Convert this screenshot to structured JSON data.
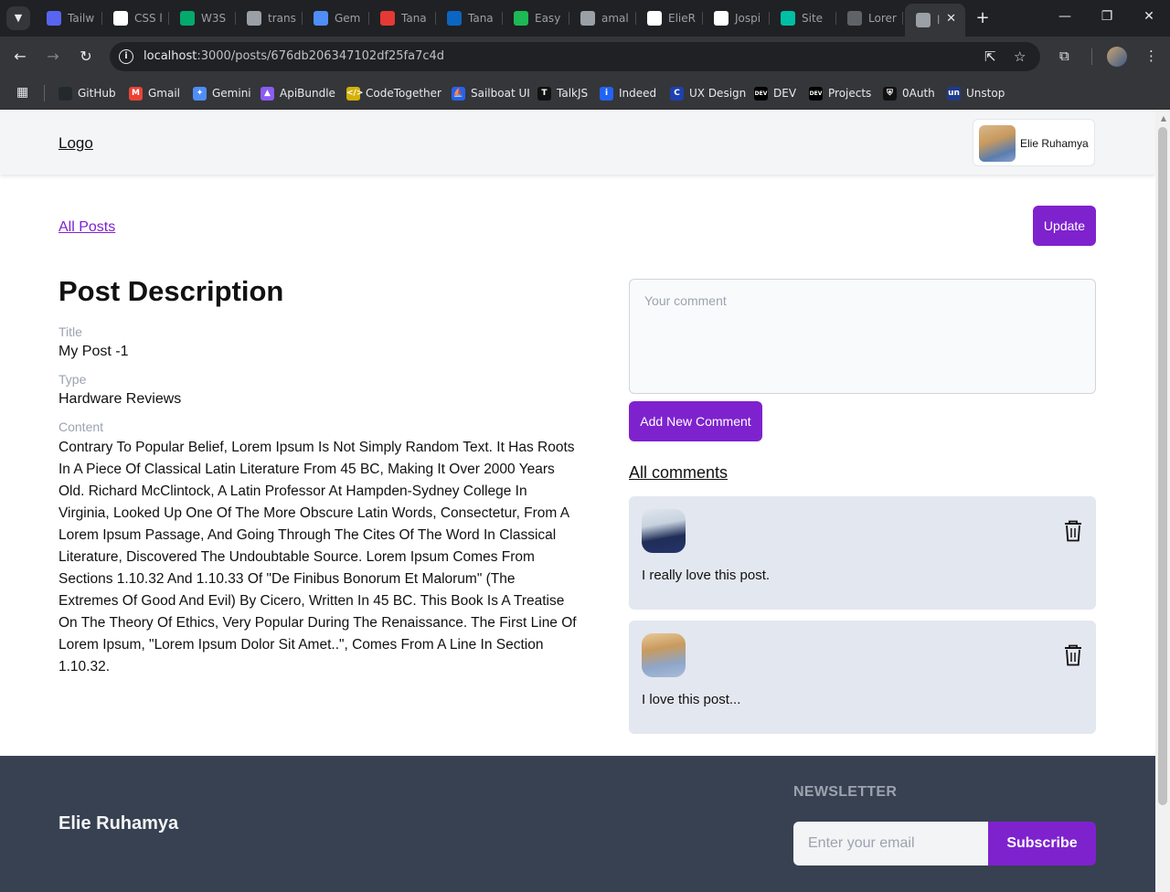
{
  "browser": {
    "tabs": [
      {
        "label": "Tailw",
        "icon": "tailwind-icon",
        "color": "#5865f2"
      },
      {
        "label": "CSS l",
        "icon": "circle-icon",
        "color": "#ffffff"
      },
      {
        "label": "W3S",
        "icon": "w3schools-icon",
        "color": "#04aa6d"
      },
      {
        "label": "trans",
        "icon": "translate-icon",
        "color": "#9aa0a6"
      },
      {
        "label": "Gem",
        "icon": "gemini-icon",
        "color": "#4f8ef7"
      },
      {
        "label": "Tana",
        "icon": "tana-icon",
        "color": "#e53935"
      },
      {
        "label": "Tana",
        "icon": "linkedin-icon",
        "color": "#0a66c2"
      },
      {
        "label": "Easy",
        "icon": "easy-icon",
        "color": "#1db954"
      },
      {
        "label": "amal",
        "icon": "globe-icon",
        "color": "#9aa0a6"
      },
      {
        "label": "ElieR",
        "icon": "github-icon",
        "color": "#ffffff"
      },
      {
        "label": "Jospi",
        "icon": "github-icon",
        "color": "#ffffff"
      },
      {
        "label": "Site",
        "icon": "diamond-icon",
        "color": "#00bfa5"
      },
      {
        "label": "Lorer",
        "icon": "lorem-icon",
        "color": "#5f6368"
      },
      {
        "label": "l",
        "icon": "globe-icon",
        "color": "#9aa0a6",
        "active": true
      }
    ],
    "url_host": "localhost",
    "url_path": ":3000/posts/676db206347102df25fa7c4d",
    "bookmarks": [
      {
        "label": "GitHub",
        "icon": "github-icon",
        "color": "#24292e",
        "glyph": ""
      },
      {
        "label": "Gmail",
        "icon": "gmail-icon",
        "color": "#ea4335",
        "glyph": "M"
      },
      {
        "label": "Gemini",
        "icon": "gemini-icon",
        "color": "#4f8ef7",
        "glyph": "✦"
      },
      {
        "label": "ApiBundle",
        "icon": "apibundle-icon",
        "color": "#8b5cf6",
        "glyph": "▲"
      },
      {
        "label": "CodeTogether",
        "icon": "codetogether-icon",
        "color": "#d4b106",
        "glyph": "</>"
      },
      {
        "label": "Sailboat UI",
        "icon": "sailboat-icon",
        "color": "#2563eb",
        "glyph": "⛵"
      },
      {
        "label": "TalkJS",
        "icon": "talkjs-icon",
        "color": "#111111",
        "glyph": "T"
      },
      {
        "label": "Indeed",
        "icon": "indeed-icon",
        "color": "#2164f3",
        "glyph": "i"
      },
      {
        "label": "UX Design",
        "icon": "uxdesign-icon",
        "color": "#1e40af",
        "glyph": "C"
      },
      {
        "label": "DEV",
        "icon": "dev-icon",
        "color": "#000000",
        "glyph": "DEV"
      },
      {
        "label": "Projects",
        "icon": "dev-icon",
        "color": "#000000",
        "glyph": "DEV"
      },
      {
        "label": "0Auth",
        "icon": "shield-icon",
        "color": "#111111",
        "glyph": "⛨"
      },
      {
        "label": "Unstop",
        "icon": "unstop-icon",
        "color": "#1e3a8a",
        "glyph": "un"
      }
    ]
  },
  "header": {
    "logo": "Logo",
    "user_name": "Elie Ruhamya"
  },
  "nav": {
    "all_posts": "All Posts",
    "update": "Update"
  },
  "post": {
    "heading": "Post Description",
    "title_label": "Title",
    "title_value": "My Post -1",
    "type_label": "Type",
    "type_value": "Hardware Reviews",
    "content_label": "Content",
    "content_value": "Contrary To Popular Belief, Lorem Ipsum Is Not Simply Random Text. It Has Roots In A Piece Of Classical Latin Literature From 45 BC, Making It Over 2000 Years Old. Richard McClintock, A Latin Professor At Hampden-Sydney College In Virginia, Looked Up One Of The More Obscure Latin Words, Consectetur, From A Lorem Ipsum Passage, And Going Through The Cites Of The Word In Classical Literature, Discovered The Undoubtable Source. Lorem Ipsum Comes From Sections 1.10.32 And 1.10.33 Of \"De Finibus Bonorum Et Malorum\" (The Extremes Of Good And Evil) By Cicero, Written In 45 BC. This Book Is A Treatise On The Theory Of Ethics, Very Popular During The Renaissance. The First Line Of Lorem Ipsum, \"Lorem Ipsum Dolor Sit Amet..\", Comes From A Line In Section 1.10.32."
  },
  "comments": {
    "placeholder": "Your comment",
    "value": "",
    "add_button": "Add New Comment",
    "heading": "All comments",
    "items": [
      {
        "text": "I really love this post."
      },
      {
        "text": "I love this post..."
      }
    ]
  },
  "footer": {
    "name": "Elie Ruhamya",
    "newsletter_title": "NEWSLETTER",
    "email_placeholder": "Enter your email",
    "subscribe": "Subscribe"
  },
  "colors": {
    "accent": "#7e22ce",
    "footer_bg": "#374151",
    "comment_bg": "#e3e7ef"
  }
}
